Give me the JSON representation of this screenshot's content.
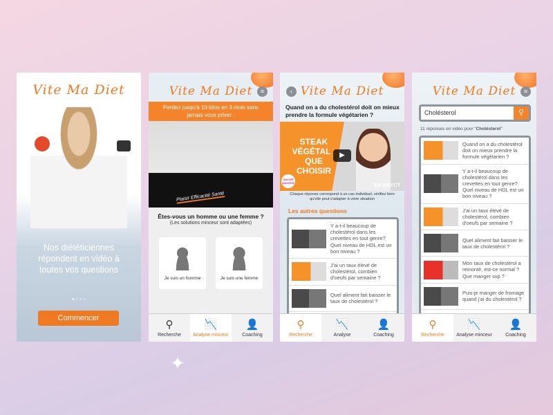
{
  "app_name": "Vite Ma Diet",
  "screen1": {
    "tagline": "Nos diététiciennes répondent en vidéo à toutes vos questions",
    "cta": "Commencer",
    "carousel_pages": 4,
    "carousel_active": 1
  },
  "screen2": {
    "banner": "Perdez jusqu'à 10 kilos en 3 mois sans jamais vous priver :",
    "image_caption": "Plaisir Efficacité Santé",
    "question": "Êtes-vous un homme ou une femme ?",
    "subtitle": "(Les solutions minceur sont adaptées)",
    "man": "Je suis un homme",
    "woman": "Je suis une femme"
  },
  "screen3": {
    "question": "Quand on a du cholestérol doit on mieux prendre la formule végétarien ?",
    "video_title": "STEAK VÉGÉTAL : QUE CHOISIR",
    "video_badge": "EN DIRECT",
    "brand_badge": "SAVOIR MAIGRIR",
    "disclaimer": "Chaque réponse correspond à un cas individuel, vérifiez bien qu'elle peut s'adapter à votre situation",
    "others_title": "Les autres questions",
    "items": [
      "Y a-t-il beaucoup de cholestérol dans les crevettes en tout genre? Quel niveau de HDL est un bon niveau ?",
      "J'ai un taux élevé de cholestérol, combien d'oeufs par semaine ?",
      "Quel aliment fait baisser le taux de cholestérol ?"
    ]
  },
  "screen4": {
    "search_value": "Cholésterol",
    "results_prefix": "11 réponses en vidéo pour \"",
    "results_term": "Cholésterol",
    "results_suffix": "\"",
    "items": [
      "Quand on a du cholestérol doit on mieux prendre la formule végétarien ?",
      "Y a-t-il beaucoup de cholestérol dans les crevettes en tout genre? Quel niveau de HDL est un bon niveau ?",
      "J'ai un taux élevé de cholestérol, combien d'oeufs par semaine ?",
      "Quel aliment fait baisser le taux de cholestérol ?",
      "Mon taux de cholestérol a remonté, est-ce normal ? Que manger svp ?",
      "Puis-je manger de fromage quand j'ai du cholestérol ?"
    ]
  },
  "nav": {
    "search": "Recherche",
    "analysis_full": "Analyse minceur",
    "analysis_short": "Analyse",
    "coaching": "Coaching"
  },
  "colors": {
    "accent": "#f07a22"
  }
}
